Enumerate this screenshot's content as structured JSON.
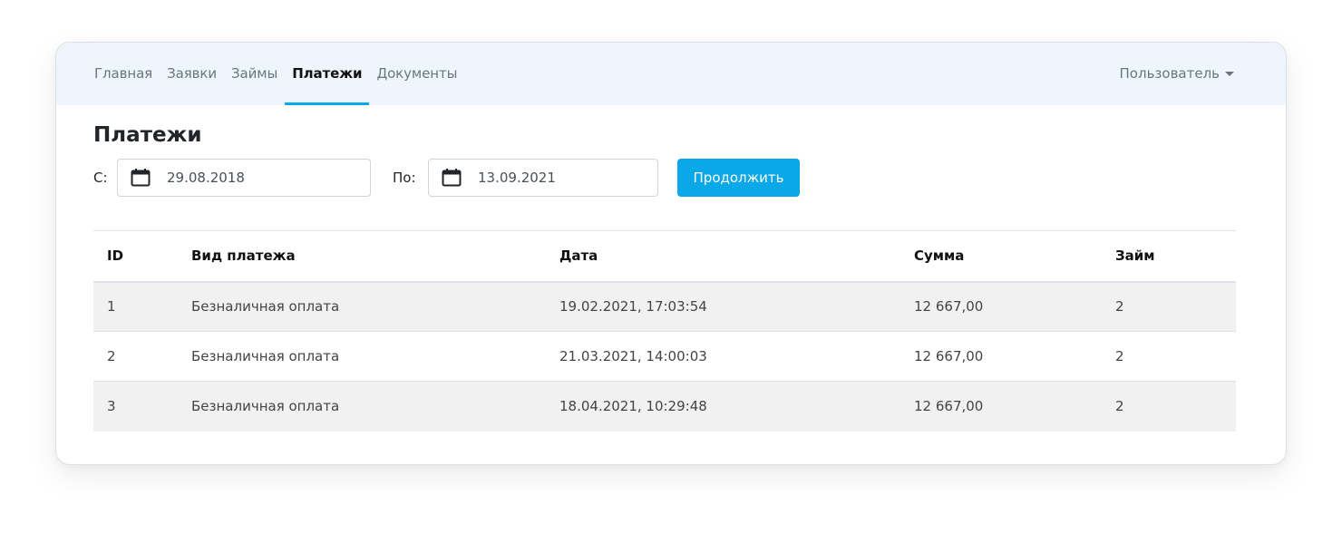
{
  "nav": {
    "items": [
      {
        "label": "Главная"
      },
      {
        "label": "Заявки"
      },
      {
        "label": "Займы"
      },
      {
        "label": "Платежи"
      },
      {
        "label": "Документы"
      }
    ],
    "active": "Платежи",
    "user_menu": "Пользователь"
  },
  "page": {
    "title": "Платежи"
  },
  "filter": {
    "from_label": "С:",
    "from_value": "29.08.2018",
    "to_label": "По:",
    "to_value": "13.09.2021",
    "submit_label": "Продолжить"
  },
  "table": {
    "headers": [
      "ID",
      "Вид платежа",
      "Дата",
      "Сумма",
      "Займ"
    ],
    "rows": [
      [
        "1",
        "Безналичная оплата",
        "19.02.2021, 17:03:54",
        "12 667,00",
        "2"
      ],
      [
        "2",
        "Безналичная оплата",
        "21.03.2021, 14:00:03",
        "12 667,00",
        "2"
      ],
      [
        "3",
        "Безналичная оплата",
        "18.04.2021, 10:29:48",
        "12 667,00",
        "2"
      ]
    ]
  },
  "colors": {
    "accent": "#0aa8e8",
    "navbar_bg": "#eef5fd",
    "stripe": "#f1f1f1"
  },
  "icons": {
    "date_picker": "calendar-icon",
    "user_dropdown": "caret-down-icon"
  }
}
